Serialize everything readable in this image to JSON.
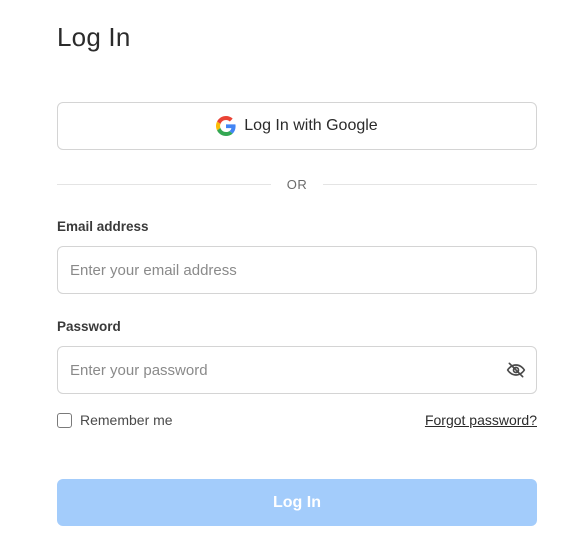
{
  "page": {
    "title": "Log In"
  },
  "google_button": {
    "label": "Log In with Google",
    "icon": "google-logo-icon"
  },
  "divider": {
    "text": "OR"
  },
  "email": {
    "label": "Email address",
    "placeholder": "Enter your email address",
    "value": ""
  },
  "password": {
    "label": "Password",
    "placeholder": "Enter your password",
    "value": "",
    "toggle_icon": "eye-off-icon"
  },
  "remember": {
    "label": "Remember me",
    "checked": false
  },
  "forgot": {
    "label": "Forgot password?"
  },
  "submit": {
    "label": "Log In"
  },
  "colors": {
    "primary_disabled": "#a3ccfb",
    "border": "#d4d4d4",
    "text": "#2b2b2b"
  }
}
